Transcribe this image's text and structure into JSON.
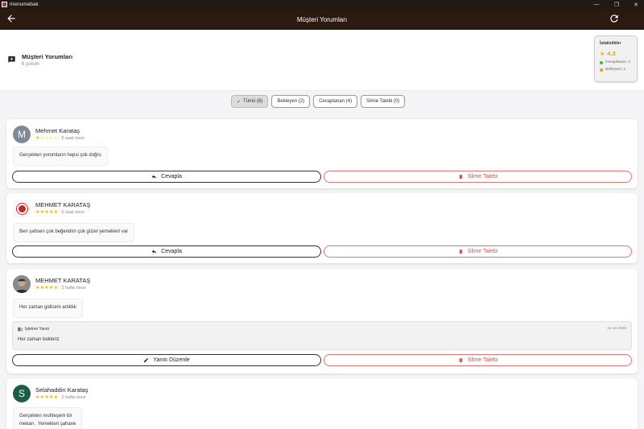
{
  "window": {
    "title": "menumebak"
  },
  "appbar": {
    "title": "Müşteri Yorumları"
  },
  "header": {
    "title": "Müşteri Yorumları",
    "subtitle": "6 yorum"
  },
  "stats": {
    "title": "İstatistikler",
    "rating": "4.3",
    "answered": "Cevaplanan: 4",
    "pending": "Bekleyen: 2",
    "colors": {
      "answered": "#4caf50",
      "pending": "#ff9800",
      "star": "#f5b400"
    }
  },
  "filters": [
    {
      "label": "Tümü (6)",
      "active": true
    },
    {
      "label": "Bekleyen (2)",
      "active": false
    },
    {
      "label": "Cevaplanan (4)",
      "active": false
    },
    {
      "label": "Silme Talebi (0)",
      "active": false
    }
  ],
  "reviews": [
    {
      "name": "Mehmet Karataş",
      "avatar_letter": "M",
      "rating": 1,
      "time": "5 saat önce",
      "text": "Gerçekten yorumların hepsi çok doğru",
      "reply_label": "Cevapla",
      "delete_label": "Silme Talebi"
    },
    {
      "name": "MEHMET KARATAŞ",
      "avatar_letter": "",
      "rating": 5,
      "time": "5 saat önce",
      "text": "Ben şahsen çok beğendim çok güzel yemekleri var",
      "reply_label": "Cevapla",
      "delete_label": "Silme Talebi"
    },
    {
      "name": "MEHMET KARATAŞ",
      "avatar_letter": "",
      "rating": 5,
      "time": "2 hafta önce",
      "text": "Her zaman gidicem artıkkk",
      "business_reply": {
        "label": "İşletme Yanıtı",
        "date": "12.10.2025",
        "text": "Her zaman bekleriz"
      },
      "reply_label": "Yanıtı Düzenle",
      "delete_label": "Silme Talebi"
    },
    {
      "name": "Selahaddin Karataş",
      "avatar_letter": "S",
      "rating": 5,
      "time": "2 hafta önce",
      "text_lines": [
        "Gerçekten muhteşem bir",
        "mekan . Yemekleri şahane"
      ]
    }
  ]
}
